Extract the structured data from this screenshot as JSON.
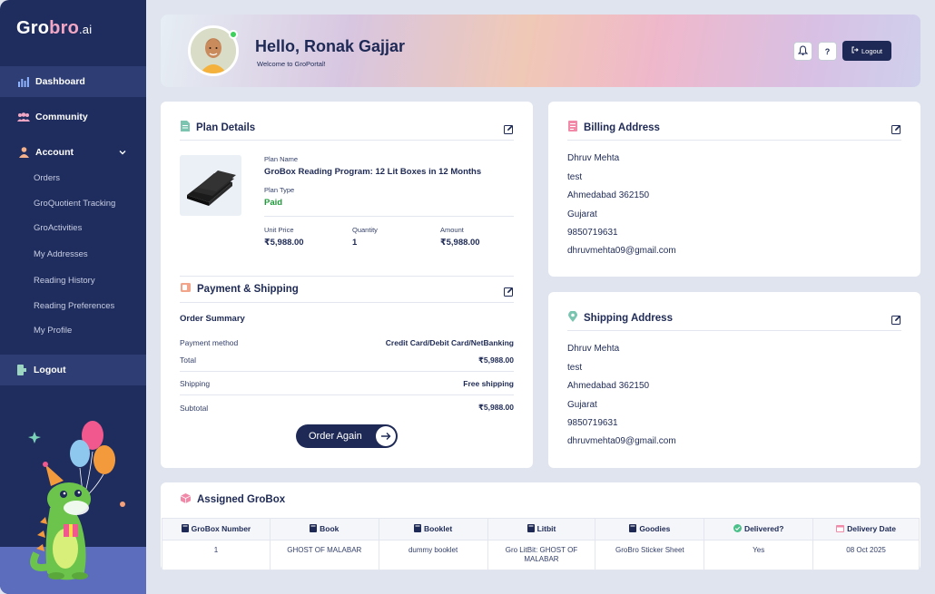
{
  "brand": {
    "logo_gro": "Gro",
    "logo_bro": "bro",
    "logo_ai": ".ai"
  },
  "sidebar": {
    "items": [
      {
        "label": "Dashboard",
        "icon": "bar-chart-icon"
      },
      {
        "label": "Community",
        "icon": "users-icon"
      },
      {
        "label": "Account",
        "icon": "user-icon"
      }
    ],
    "sub_items": [
      "Orders",
      "GroQuotient Tracking",
      "GroActivities",
      "My Addresses",
      "Reading History",
      "Reading Preferences",
      "My Profile"
    ],
    "logout": "Logout"
  },
  "header": {
    "greeting": "Hello, Ronak Gajjar",
    "subtitle": "Welcome to GroPortal!",
    "help_label": "?",
    "logout_label": "Logout"
  },
  "plan": {
    "title": "Plan Details",
    "plan_name_label": "Plan Name",
    "plan_name": "GroBox Reading Program: 12 Lit Boxes in 12 Months",
    "plan_type_label": "Plan Type",
    "plan_type": "Paid",
    "unit_price_label": "Unit Price",
    "unit_price": "₹5,988.00",
    "quantity_label": "Quantity",
    "quantity": "1",
    "amount_label": "Amount",
    "amount": "₹5,988.00"
  },
  "payment": {
    "title": "Payment & Shipping",
    "summary_title": "Order Summary",
    "rows": [
      {
        "label": "Payment method",
        "value": "Credit Card/Debit Card/NetBanking"
      },
      {
        "label": "Total",
        "value": "₹5,988.00"
      },
      {
        "label": "Shipping",
        "value": "Free shipping"
      },
      {
        "label": "Subtotal",
        "value": "₹5,988.00"
      }
    ],
    "order_again": "Order Again"
  },
  "billing": {
    "title": "Billing Address",
    "lines": [
      "Dhruv Mehta",
      "test",
      "Ahmedabad 362150",
      "Gujarat",
      "9850719631",
      "dhruvmehta09@gmail.com"
    ]
  },
  "shipping": {
    "title": "Shipping Address",
    "lines": [
      "Dhruv Mehta",
      "test",
      "Ahmedabad 362150",
      "Gujarat",
      "9850719631",
      "dhruvmehta09@gmail.com"
    ]
  },
  "grobox": {
    "title": "Assigned GroBox",
    "headers": [
      "GroBox Number",
      "Book",
      "Booklet",
      "Litbit",
      "Goodies",
      "Delivered?",
      "Delivery Date"
    ],
    "rows": [
      [
        "1",
        "GHOST OF MALABAR",
        "dummy booklet",
        "Gro LitBit: GHOST OF MALABAR",
        "GroBro Sticker Sheet",
        "Yes",
        "08 Oct 2025"
      ]
    ]
  },
  "colors": {
    "navy": "#1e2a55",
    "sidebar": "#1f2d5e",
    "paid_green": "#1f9a3a",
    "online_green": "#3ccf5c"
  }
}
